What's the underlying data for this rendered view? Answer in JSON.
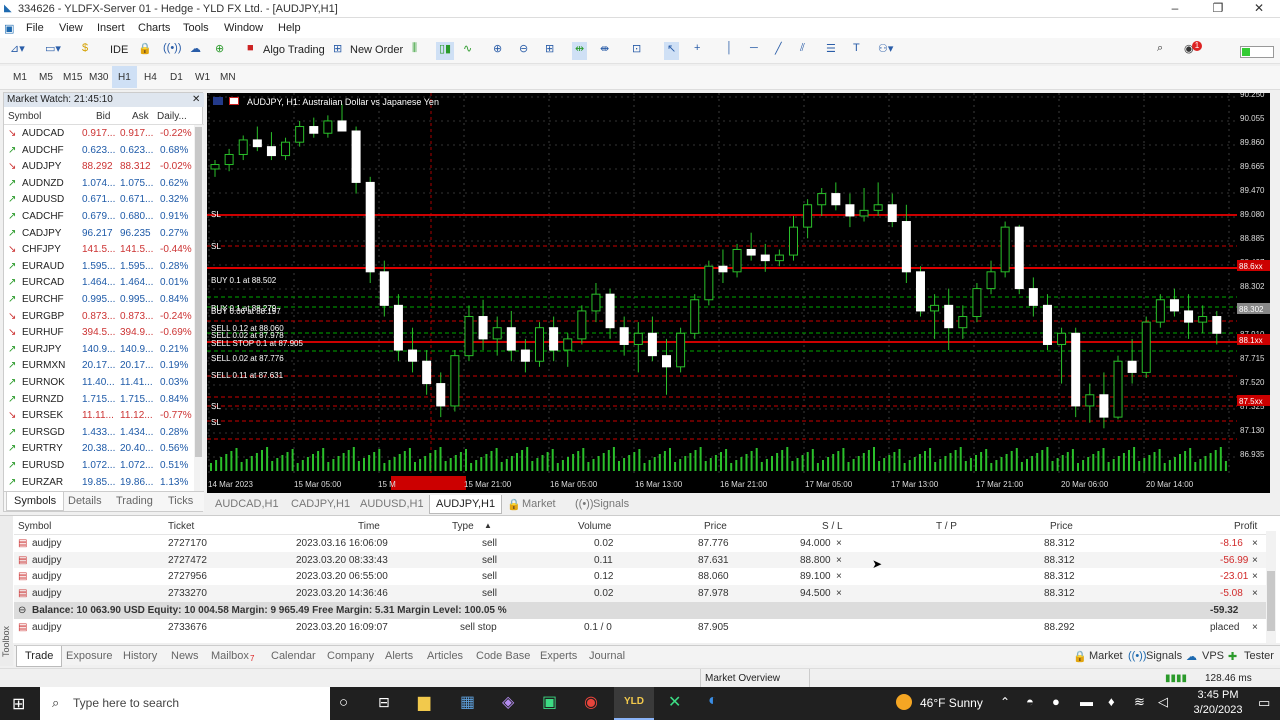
{
  "window": {
    "title": "334626 - YLDFX-Server 01 - Hedge - YLD FX Ltd. - [AUDJPY,H1]"
  },
  "menu": [
    "File",
    "View",
    "Insert",
    "Charts",
    "Tools",
    "Window",
    "Help"
  ],
  "toolbar": {
    "ide": "IDE",
    "algo": "Algo Trading",
    "new_order": "New Order"
  },
  "timeframes": [
    "M1",
    "M5",
    "M15",
    "M30",
    "H1",
    "H4",
    "D1",
    "W1",
    "MN"
  ],
  "market_watch": {
    "title": "Market Watch: 21:45:10",
    "columns": [
      "Symbol",
      "Bid",
      "Ask",
      "Daily..."
    ],
    "rows": [
      [
        "AUDCAD",
        "0.917...",
        "0.917...",
        "-0.22%"
      ],
      [
        "AUDCHF",
        "0.623...",
        "0.623...",
        "0.68%"
      ],
      [
        "AUDJPY",
        "88.292",
        "88.312",
        "-0.02%"
      ],
      [
        "AUDNZD",
        "1.074...",
        "1.075...",
        "0.62%"
      ],
      [
        "AUDUSD",
        "0.671...",
        "0.671...",
        "0.32%"
      ],
      [
        "CADCHF",
        "0.679...",
        "0.680...",
        "0.91%"
      ],
      [
        "CADJPY",
        "96.217",
        "96.235",
        "0.27%"
      ],
      [
        "CHFJPY",
        "141.5...",
        "141.5...",
        "-0.44%"
      ],
      [
        "EURAUD",
        "1.595...",
        "1.595...",
        "0.28%"
      ],
      [
        "EURCAD",
        "1.464...",
        "1.464...",
        "0.01%"
      ],
      [
        "EURCHF",
        "0.995...",
        "0.995...",
        "0.84%"
      ],
      [
        "EURGBP",
        "0.873...",
        "0.873...",
        "-0.24%"
      ],
      [
        "EURHUF",
        "394.5...",
        "394.9...",
        "-0.69%"
      ],
      [
        "EURJPY",
        "140.9...",
        "140.9...",
        "0.21%"
      ],
      [
        "EURMXN",
        "20.17...",
        "20.17...",
        "0.19%"
      ],
      [
        "EURNOK",
        "11.40...",
        "11.41...",
        "0.03%"
      ],
      [
        "EURNZD",
        "1.715...",
        "1.715...",
        "0.84%"
      ],
      [
        "EURSEK",
        "11.11...",
        "11.12...",
        "-0.77%"
      ],
      [
        "EURSGD",
        "1.433...",
        "1.434...",
        "0.28%"
      ],
      [
        "EURTRY",
        "20.38...",
        "20.40...",
        "0.56%"
      ],
      [
        "EURUSD",
        "1.072...",
        "1.072...",
        "0.51%"
      ],
      [
        "EURZAR",
        "19.85...",
        "19.86...",
        "1.13%"
      ]
    ],
    "tabs": [
      "Symbols",
      "Details",
      "Trading",
      "Ticks"
    ]
  },
  "chart": {
    "header": "AUDJPY, H1:  Australian Dollar vs Japanese Yen",
    "price_labels": [
      "90.250",
      "90.055",
      "89.860",
      "89.665",
      "89.470",
      "89.080",
      "88.885",
      "88.497",
      "88.302",
      "88.105",
      "87.910",
      "87.715",
      "87.520",
      "87.325",
      "87.130",
      "86.935"
    ],
    "tag_prices": [
      "88.6xx",
      "88.302",
      "88.1xx",
      "87.5xx"
    ],
    "time_labels": [
      "14 Mar 2023",
      "15 Mar 05:00",
      "15 M",
      "15 Mar 21:00",
      "16 Mar 05:00",
      "16 Mar 13:00",
      "16 Mar 21:00",
      "17 Mar 05:00",
      "17 Mar 13:00",
      "17 Mar 21:00",
      "20 Mar 06:00",
      "20 Mar 14:00"
    ],
    "order_labels": [
      "SL",
      "SL",
      "BUY 0.1 at 88.502",
      "BUY 0.1 at 88.279",
      "BUY 0.06 at 88.197",
      "SELL 0.12 at 88.060",
      "SELL 0.02 at 87.978",
      "SELL STOP 0.1 at 87.905",
      "SELL 0.02 at 87.776",
      "SELL 0.11 at 87.631",
      "SL",
      "SL"
    ],
    "candles": [
      {
        "o": 89.62,
        "h": 89.7,
        "l": 89.55,
        "c": 89.66
      },
      {
        "o": 89.66,
        "h": 89.8,
        "l": 89.6,
        "c": 89.75
      },
      {
        "o": 89.75,
        "h": 89.92,
        "l": 89.7,
        "c": 89.88
      },
      {
        "o": 89.88,
        "h": 90.0,
        "l": 89.78,
        "c": 89.82
      },
      {
        "o": 89.82,
        "h": 89.95,
        "l": 89.7,
        "c": 89.74
      },
      {
        "o": 89.74,
        "h": 89.9,
        "l": 89.7,
        "c": 89.86
      },
      {
        "o": 89.86,
        "h": 90.05,
        "l": 89.82,
        "c": 90.0
      },
      {
        "o": 90.0,
        "h": 90.08,
        "l": 89.9,
        "c": 89.94
      },
      {
        "o": 89.94,
        "h": 90.1,
        "l": 89.9,
        "c": 90.05
      },
      {
        "o": 90.05,
        "h": 90.2,
        "l": 89.98,
        "c": 89.96
      },
      {
        "o": 89.96,
        "h": 90.0,
        "l": 89.4,
        "c": 89.5
      },
      {
        "o": 89.5,
        "h": 89.55,
        "l": 88.6,
        "c": 88.7
      },
      {
        "o": 88.7,
        "h": 88.8,
        "l": 88.3,
        "c": 88.4
      },
      {
        "o": 88.4,
        "h": 88.5,
        "l": 87.9,
        "c": 88.0
      },
      {
        "o": 88.0,
        "h": 88.2,
        "l": 87.8,
        "c": 87.9
      },
      {
        "o": 87.9,
        "h": 88.0,
        "l": 87.6,
        "c": 87.7
      },
      {
        "o": 87.7,
        "h": 87.8,
        "l": 87.4,
        "c": 87.5
      },
      {
        "o": 87.5,
        "h": 88.0,
        "l": 87.45,
        "c": 87.95
      },
      {
        "o": 87.95,
        "h": 88.4,
        "l": 87.9,
        "c": 88.3
      },
      {
        "o": 88.3,
        "h": 88.45,
        "l": 88.0,
        "c": 88.1
      },
      {
        "o": 88.1,
        "h": 88.3,
        "l": 87.95,
        "c": 88.2
      },
      {
        "o": 88.2,
        "h": 88.35,
        "l": 87.9,
        "c": 88.0
      },
      {
        "o": 88.0,
        "h": 88.1,
        "l": 87.8,
        "c": 87.9
      },
      {
        "o": 87.9,
        "h": 88.25,
        "l": 87.85,
        "c": 88.2
      },
      {
        "o": 88.2,
        "h": 88.3,
        "l": 87.9,
        "c": 88.0
      },
      {
        "o": 88.0,
        "h": 88.15,
        "l": 87.85,
        "c": 88.1
      },
      {
        "o": 88.1,
        "h": 88.4,
        "l": 88.05,
        "c": 88.35
      },
      {
        "o": 88.35,
        "h": 88.6,
        "l": 88.25,
        "c": 88.5
      },
      {
        "o": 88.5,
        "h": 88.55,
        "l": 88.1,
        "c": 88.2
      },
      {
        "o": 88.2,
        "h": 88.3,
        "l": 87.95,
        "c": 88.05
      },
      {
        "o": 88.05,
        "h": 88.25,
        "l": 87.8,
        "c": 88.15
      },
      {
        "o": 88.15,
        "h": 88.3,
        "l": 87.9,
        "c": 87.95
      },
      {
        "o": 87.95,
        "h": 88.1,
        "l": 87.6,
        "c": 87.85
      },
      {
        "o": 87.85,
        "h": 88.2,
        "l": 87.8,
        "c": 88.15
      },
      {
        "o": 88.15,
        "h": 88.5,
        "l": 88.1,
        "c": 88.45
      },
      {
        "o": 88.45,
        "h": 88.8,
        "l": 88.4,
        "c": 88.75
      },
      {
        "o": 88.75,
        "h": 88.9,
        "l": 88.6,
        "c": 88.7
      },
      {
        "o": 88.7,
        "h": 88.95,
        "l": 88.65,
        "c": 88.9
      },
      {
        "o": 88.9,
        "h": 89.05,
        "l": 88.8,
        "c": 88.85
      },
      {
        "o": 88.85,
        "h": 88.95,
        "l": 88.7,
        "c": 88.8
      },
      {
        "o": 88.8,
        "h": 88.9,
        "l": 88.75,
        "c": 88.85
      },
      {
        "o": 88.85,
        "h": 89.2,
        "l": 88.8,
        "c": 89.1
      },
      {
        "o": 89.1,
        "h": 89.35,
        "l": 89.0,
        "c": 89.3
      },
      {
        "o": 89.3,
        "h": 89.45,
        "l": 89.2,
        "c": 89.4
      },
      {
        "o": 89.4,
        "h": 89.5,
        "l": 89.25,
        "c": 89.3
      },
      {
        "o": 89.3,
        "h": 89.4,
        "l": 89.1,
        "c": 89.2
      },
      {
        "o": 89.2,
        "h": 89.45,
        "l": 89.15,
        "c": 89.25
      },
      {
        "o": 89.25,
        "h": 89.5,
        "l": 89.2,
        "c": 89.3
      },
      {
        "o": 89.3,
        "h": 89.4,
        "l": 89.1,
        "c": 89.15
      },
      {
        "o": 89.15,
        "h": 89.3,
        "l": 88.6,
        "c": 88.7
      },
      {
        "o": 88.7,
        "h": 88.75,
        "l": 88.3,
        "c": 88.35
      },
      {
        "o": 88.35,
        "h": 88.5,
        "l": 88.1,
        "c": 88.4
      },
      {
        "o": 88.4,
        "h": 88.55,
        "l": 88.0,
        "c": 88.2
      },
      {
        "o": 88.2,
        "h": 88.4,
        "l": 88.1,
        "c": 88.3
      },
      {
        "o": 88.3,
        "h": 88.6,
        "l": 88.25,
        "c": 88.55
      },
      {
        "o": 88.55,
        "h": 88.8,
        "l": 88.5,
        "c": 88.7
      },
      {
        "o": 88.7,
        "h": 89.15,
        "l": 88.65,
        "c": 89.1
      },
      {
        "o": 89.1,
        "h": 89.12,
        "l": 88.5,
        "c": 88.55
      },
      {
        "o": 88.55,
        "h": 88.65,
        "l": 88.3,
        "c": 88.4
      },
      {
        "o": 88.4,
        "h": 88.5,
        "l": 88.0,
        "c": 88.05
      },
      {
        "o": 88.05,
        "h": 88.2,
        "l": 87.7,
        "c": 88.15
      },
      {
        "o": 88.15,
        "h": 88.2,
        "l": 87.4,
        "c": 87.5
      },
      {
        "o": 87.5,
        "h": 87.7,
        "l": 87.35,
        "c": 87.6
      },
      {
        "o": 87.6,
        "h": 87.8,
        "l": 87.3,
        "c": 87.4
      },
      {
        "o": 87.4,
        "h": 87.95,
        "l": 87.38,
        "c": 87.9
      },
      {
        "o": 87.9,
        "h": 88.1,
        "l": 87.7,
        "c": 87.8
      },
      {
        "o": 87.8,
        "h": 88.3,
        "l": 87.75,
        "c": 88.25
      },
      {
        "o": 88.25,
        "h": 88.5,
        "l": 88.2,
        "c": 88.45
      },
      {
        "o": 88.45,
        "h": 88.55,
        "l": 88.3,
        "c": 88.35
      },
      {
        "o": 88.35,
        "h": 88.5,
        "l": 88.1,
        "c": 88.25
      },
      {
        "o": 88.25,
        "h": 88.4,
        "l": 88.15,
        "c": 88.3
      },
      {
        "o": 88.3,
        "h": 88.35,
        "l": 88.05,
        "c": 88.15
      }
    ]
  },
  "chart_tabs": [
    "AUDCAD,H1",
    "CADJPY,H1",
    "AUDUSD,H1",
    "AUDJPY,H1",
    "Market",
    "Signals"
  ],
  "trade": {
    "columns": [
      "Symbol",
      "Ticket",
      "Time",
      "Type",
      "Volume",
      "Price",
      "S / L",
      "T / P",
      "Price",
      "Profit"
    ],
    "positions": [
      {
        "symbol": "audjpy",
        "ticket": "2727170",
        "time": "2023.03.16 16:06:09",
        "type": "sell",
        "volume": "0.02",
        "price": "87.776",
        "sl": "94.000",
        "x": "×",
        "cur": "88.312",
        "profit": "-8.16"
      },
      {
        "symbol": "audjpy",
        "ticket": "2727472",
        "time": "2023.03.20 08:33:43",
        "type": "sell",
        "volume": "0.11",
        "price": "87.631",
        "sl": "88.800",
        "x": "×",
        "cur": "88.312",
        "profit": "-56.99"
      },
      {
        "symbol": "audjpy",
        "ticket": "2727956",
        "time": "2023.03.20 06:55:00",
        "type": "sell",
        "volume": "0.12",
        "price": "88.060",
        "sl": "89.100",
        "x": "×",
        "cur": "88.312",
        "profit": "-23.01"
      },
      {
        "symbol": "audjpy",
        "ticket": "2733270",
        "time": "2023.03.20 14:36:46",
        "type": "sell",
        "volume": "0.02",
        "price": "87.978",
        "sl": "94.500",
        "x": "×",
        "cur": "88.312",
        "profit": "-5.08"
      }
    ],
    "balance": "Balance: 10 063.90 USD  Equity: 10 004.58  Margin: 9 965.49  Free Margin: 5.31  Margin Level: 100.05 %",
    "balance_profit": "-59.32",
    "order": {
      "symbol": "audjpy",
      "ticket": "2733676",
      "time": "2023.03.20 16:09:07",
      "type": "sell stop",
      "volume": "0.1 / 0",
      "price": "87.905",
      "cur": "88.292",
      "state": "placed"
    }
  },
  "bottom_tabs": [
    "Trade",
    "Exposure",
    "History",
    "News",
    "Mailbox",
    "Calendar",
    "Company",
    "Alerts",
    "Articles",
    "Code Base",
    "Experts",
    "Journal"
  ],
  "bottom_right": [
    "Market",
    "Signals",
    "VPS",
    "Tester"
  ],
  "mailbox_badge": "7",
  "toolbox": "Toolbox",
  "status": {
    "overview": "Market Overview",
    "ping": "128.46 ms"
  },
  "taskbar": {
    "search": "Type here to search",
    "weather": "46°F  Sunny",
    "time": "3:45 PM",
    "date": "3/20/2023"
  }
}
